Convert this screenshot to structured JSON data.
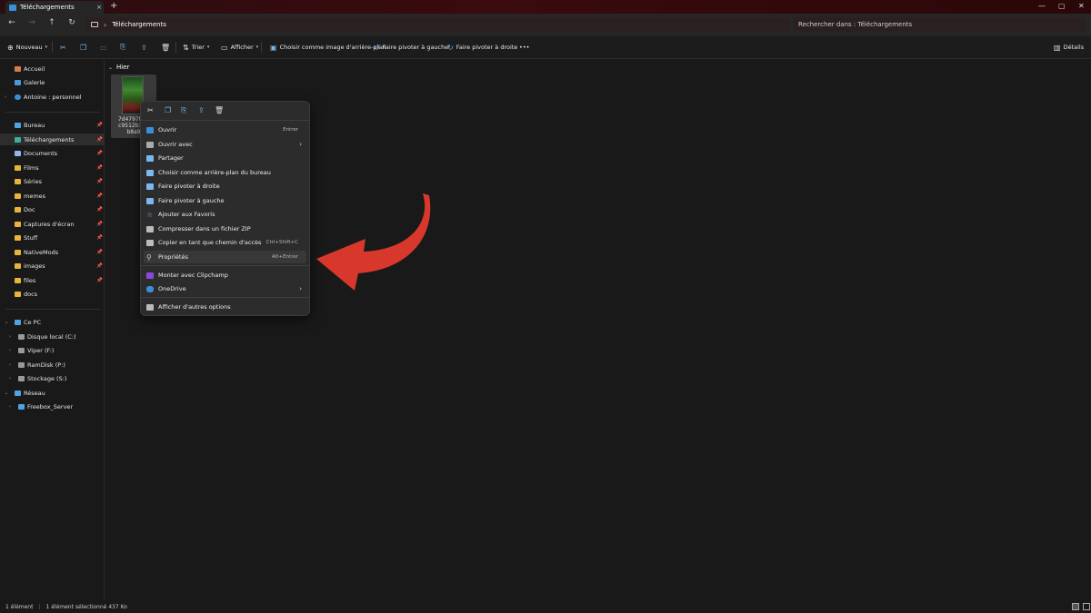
{
  "tab": {
    "title": "Téléchargements",
    "close": "×",
    "new": "+"
  },
  "window": {
    "minimize": "—",
    "maximize": "▢",
    "close": "✕"
  },
  "address": {
    "back": "←",
    "forward": "→",
    "up": "↑",
    "refresh": "↻",
    "chevron": "›",
    "crumb": "Téléchargements",
    "search_placeholder": "Rechercher dans : Téléchargements"
  },
  "toolbar": {
    "new": "Nouveau",
    "sort": "Trier",
    "view": "Afficher",
    "set_wallpaper": "Choisir comme image d'arrière-plan",
    "rotate_left": "Faire pivoter à gauche",
    "rotate_right": "Faire pivoter à droite",
    "more": "•••",
    "details": "Détails"
  },
  "sidebar": {
    "home": "Accueil",
    "gallery": "Galerie",
    "onedrive": "Antoine : personnel",
    "quick": [
      "Bureau",
      "Téléchargements",
      "Documents",
      "Films",
      "Séries",
      "memes",
      "Doc",
      "Captures d'écran",
      "Stuff",
      "NativeMods",
      "images",
      "files",
      "docs"
    ],
    "thispc": "Ce PC",
    "drives": [
      "Disque local (C:)",
      "Viper (F:)",
      "RamDisk (P:)",
      "Stockage (S:)"
    ],
    "network": "Réseau",
    "server": "Freebox_Server"
  },
  "group": {
    "label": "Hier"
  },
  "file": {
    "line1": "7d4797bb7",
    "line2": "c9512b3ab",
    "line3": "b8a9"
  },
  "context_menu": {
    "items": [
      {
        "label": "Ouvrir",
        "shortcut": "Entrer"
      },
      {
        "label": "Ouvrir avec",
        "shortcut": ""
      },
      {
        "label": "Partager",
        "shortcut": ""
      },
      {
        "label": "Choisir comme arrière-plan du bureau",
        "shortcut": ""
      },
      {
        "label": "Faire pivoter à droite",
        "shortcut": ""
      },
      {
        "label": "Faire pivoter à gauche",
        "shortcut": ""
      },
      {
        "label": "Ajouter aux Favoris",
        "shortcut": ""
      },
      {
        "label": "Compresser dans un fichier ZIP",
        "shortcut": ""
      },
      {
        "label": "Copier en tant que chemin d'accès",
        "shortcut": "Ctrl+Shift+C"
      },
      {
        "label": "Propriétés",
        "shortcut": "Alt+Entrer"
      },
      {
        "label": "Monter avec Clipchamp",
        "shortcut": ""
      },
      {
        "label": "OneDrive",
        "shortcut": ""
      },
      {
        "label": "Afficher d'autres options",
        "shortcut": ""
      }
    ]
  },
  "status": {
    "count": "1 élément",
    "selected": "1 élément sélectionné 437 Ko"
  },
  "colors": {
    "accent": "#7ab8ef",
    "arrow": "#d8382c",
    "folder": "#e8b43a"
  }
}
